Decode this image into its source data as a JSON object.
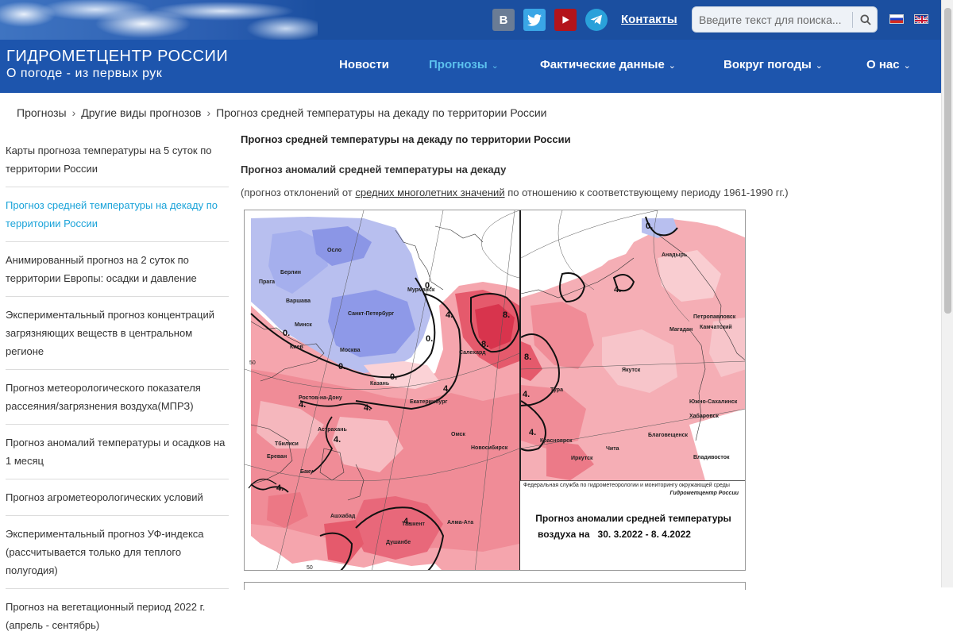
{
  "header": {
    "contacts_label": "Контакты",
    "search_placeholder": "Введите текст для поиска...",
    "social": {
      "vk": "В"
    }
  },
  "brand": {
    "title": "ГИДРОМЕТЦЕНТР РОССИИ",
    "subtitle": "О погоде - из первых рук"
  },
  "nav": {
    "items": [
      {
        "label": "Новости"
      },
      {
        "label": "Прогнозы"
      },
      {
        "label": "Фактические данные"
      },
      {
        "label": "Вокруг погоды"
      },
      {
        "label": "О нас"
      }
    ],
    "chevron": "⌄"
  },
  "breadcrumb": {
    "items": [
      "Прогнозы",
      "Другие виды прогнозов",
      "Прогноз средней температуры на декаду по территории России"
    ],
    "separator": "›"
  },
  "sidebar": {
    "items": [
      {
        "label": "Карты прогноза температуры на 5 суток по территории России"
      },
      {
        "label": "Прогноз средней температуры на декаду по территории России"
      },
      {
        "label": "Анимированный прогноз на 2 суток по территории Европы: осадки и давление"
      },
      {
        "label": "Экспериментальный прогноз концентраций загрязняющих веществ в центральном регионе"
      },
      {
        "label": "Прогноз метеорологического показателя рассеяния/загрязнения воздуха(МПРЗ)"
      },
      {
        "label": "Прогноз аномалий температуры и осадков на 1 месяц"
      },
      {
        "label": "Прогноз агрометеорологических условий"
      },
      {
        "label": "Экспериментальный прогноз УФ-индекса (рассчитывается только для теплого полугодия)"
      },
      {
        "label": "Прогноз на вегетационный период 2022 г. (апрель - сентябрь)"
      }
    ]
  },
  "main": {
    "title": "Прогноз средней температуры на декаду по территории России",
    "subtitle": "Прогноз аномалий средней температуры на декаду",
    "note_prefix": "(прогноз отклонений от ",
    "note_link": "средних многолетних значений",
    "note_suffix": " по отношению к соответствующему периоду 1961-1990 гг.)"
  },
  "map": {
    "agency": "Федеральная служба по гидрометеорологии и мониторингу окружающей среды",
    "org": "Гидрометцентр России",
    "caption_line1": "Прогноз аномалии средней температуры",
    "caption_line2_label": "воздуха на",
    "caption_line2_dates": "30. 3.2022 -  8. 4.2022",
    "cities": [
      "Осло",
      "Берлин",
      "Прага",
      "Варшава",
      "Минск",
      "Санкт-Петербург",
      "Киев",
      "Москва",
      "Мурманск",
      "Салехард",
      "Казань",
      "Екатеринбург",
      "Ростов-на-Дону",
      "Астрахань",
      "Тбилиси",
      "Ереван",
      "Баку",
      "Омск",
      "Новосибирск",
      "Ашхабад",
      "Ташкент",
      "Алма-Ата",
      "Душанбе",
      "Анадырь",
      "Петропавловск",
      "Камчатский",
      "Магадан",
      "Якутск",
      "Южно-Сахалинск",
      "Хабаровск",
      "Благовещенск",
      "Владивосток",
      "Тура",
      "Красноярск",
      "Иркутск",
      "Чита"
    ],
    "isolines": [
      "0.",
      "4.",
      "8."
    ],
    "lat_label": "50"
  },
  "colors": {
    "topbar": "#1b4fa0",
    "navbar": "#1d55ad",
    "active_link": "#1aa3d9",
    "nav_active": "#5cc1ee"
  }
}
